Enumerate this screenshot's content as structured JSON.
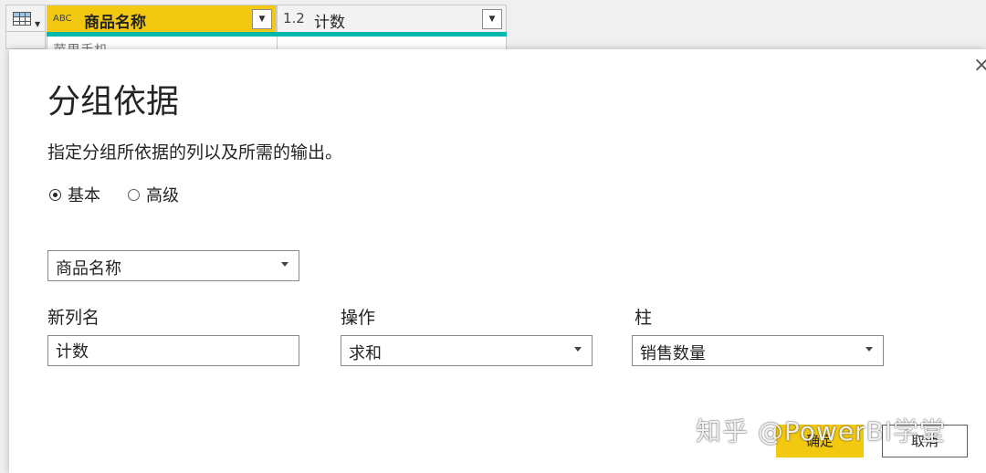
{
  "grid": {
    "columns": [
      {
        "type_icon": "ABC",
        "name": "商品名称"
      },
      {
        "type_icon": "1.2",
        "name": "计数"
      }
    ],
    "first_row_value": "苹果手机",
    "accent_color": "#01b8aa",
    "selected_header_color": "#f2c811"
  },
  "dialog": {
    "close_glyph": "×",
    "title": "分组依据",
    "description": "指定分组所依据的列以及所需的输出。",
    "mode_options": [
      {
        "label": "基本",
        "selected": true
      },
      {
        "label": "高级",
        "selected": false
      }
    ],
    "group_by_value": "商品名称",
    "new_column_label": "新列名",
    "new_column_value": "计数",
    "operation_label": "操作",
    "operation_value": "求和",
    "column_label": "柱",
    "column_value": "销售数量",
    "ok_label": "确定",
    "cancel_label": "取消"
  },
  "watermark": "知乎 @PowerBI学堂"
}
